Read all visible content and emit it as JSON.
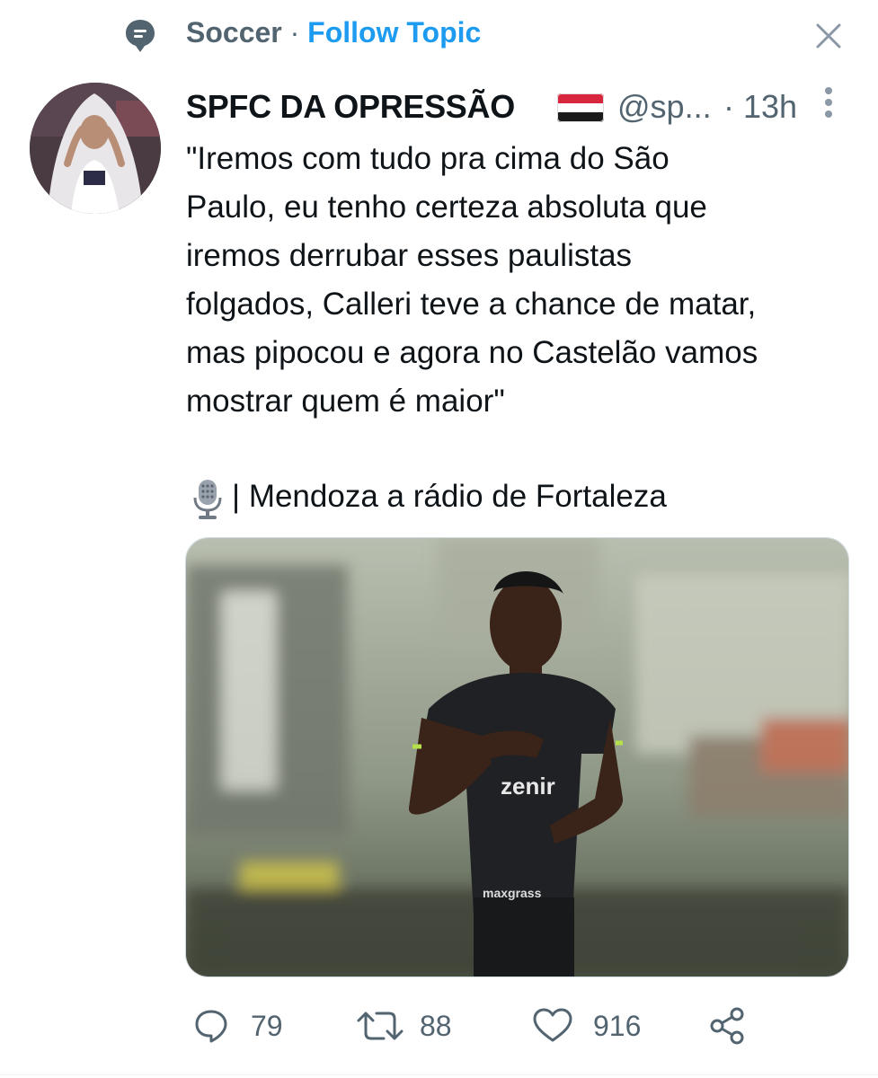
{
  "topic": {
    "name": "Soccer",
    "separator": "·",
    "follow_label": "Follow Topic"
  },
  "tweet": {
    "author_name": "SPFC DA OPRESSÃO",
    "handle": "@sp...",
    "time": "· 13h",
    "text": "\"Iremos com tudo pra cima do São\nPaulo, eu tenho certeza absoluta que\niremos derrubar esses paulistas\nfolgados, Calleri teve a chance de matar,\nmas pipocou e agora no Castelão vamos\nmostrar quem é maior\"",
    "source_line": "| Mendoza a rádio de Fortaleza",
    "media_text": {
      "shirt_sponsor": "zenir",
      "shorts_sponsor": "maxgrass"
    }
  },
  "actions": {
    "replies": "79",
    "retweets": "88",
    "likes": "916"
  },
  "colors": {
    "accent": "#1d9bf0",
    "secondary_text": "#536471",
    "primary_text": "#0f1419"
  },
  "icons": [
    "topic-icon",
    "close-icon",
    "flag-icon",
    "more-icon",
    "microphone-icon",
    "reply-icon",
    "retweet-icon",
    "like-icon",
    "share-icon"
  ]
}
